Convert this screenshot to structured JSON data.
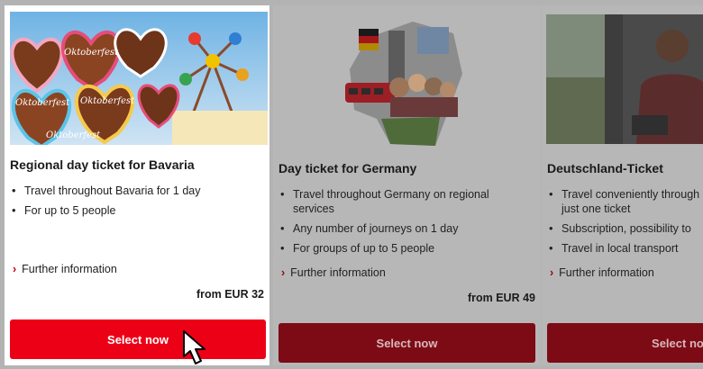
{
  "cards": [
    {
      "title": "Regional day ticket for Bavaria",
      "features": [
        "Travel throughout Bavaria for 1 day",
        "For up to 5 people"
      ],
      "further": "Further information",
      "price": "from EUR 32",
      "button": "Select now",
      "image": "oktoberfest-gingerbread-hearts-photo",
      "state": "active"
    },
    {
      "title": "Day ticket for Germany",
      "features": [
        "Travel throughout Germany on regional services",
        "Any number of journeys on 1 day",
        "For groups of up to 5 people"
      ],
      "further": "Further information",
      "price": "from EUR 49",
      "button": "Select now",
      "image": "germany-map-collage-photo",
      "state": "dimmed"
    },
    {
      "title": "Deutschland-Ticket",
      "features": [
        "Travel conveniently through just one ticket",
        "Subscription, possibility to",
        "Travel in local transport"
      ],
      "further": "Further information",
      "button": "Select now",
      "image": "train-passenger-photo",
      "state": "dimmed"
    }
  ],
  "colors": {
    "accent": "#ec0016",
    "accent_dimmed": "#7d0b15",
    "overlay": "#b3b3b3"
  },
  "cursor": "pointer-arrow-icon"
}
